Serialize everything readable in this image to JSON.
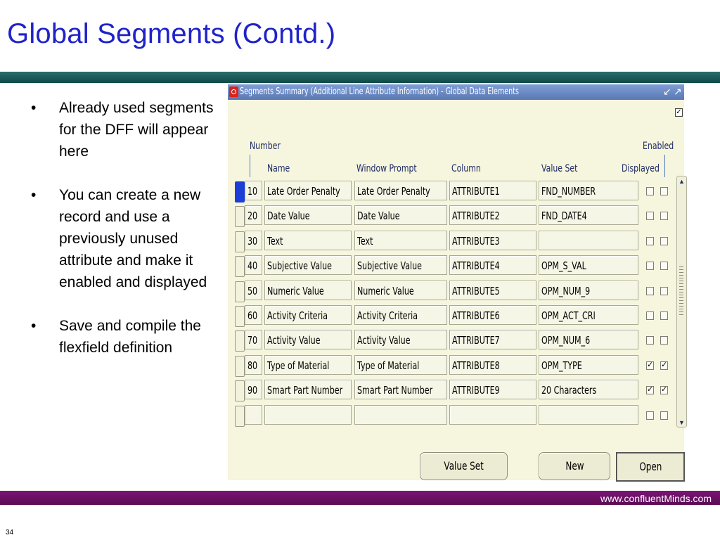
{
  "slide": {
    "title": "Global Segments (Contd.)",
    "bullets": [
      "Already used segments for the DFF will appear here",
      "You can create a new record and use a previously unused attribute and make it enabled and displayed",
      "Save and compile the flexfield definition"
    ],
    "bullet_char": "•",
    "website": "www.confluentMinds.com",
    "page_number": "34"
  },
  "window": {
    "title": "Segments Summary (Additional Line Attribute Information) - Global Data Elements",
    "header_check": "✓",
    "headers": {
      "number": "Number",
      "name": "Name",
      "window_prompt": "Window Prompt",
      "column": "Column",
      "value_set": "Value Set",
      "enabled": "Enabled",
      "displayed": "Displayed"
    },
    "rows": [
      {
        "number": "10",
        "name": "Late Order Penalty",
        "prompt": "Late Order Penalty",
        "column": "ATTRIBUTE1",
        "value_set": "FND_NUMBER",
        "enabled": "",
        "displayed": ""
      },
      {
        "number": "20",
        "name": "Date Value",
        "prompt": "Date Value",
        "column": "ATTRIBUTE2",
        "value_set": "FND_DATE4",
        "enabled": "",
        "displayed": ""
      },
      {
        "number": "30",
        "name": "Text",
        "prompt": "Text",
        "column": "ATTRIBUTE3",
        "value_set": "",
        "enabled": "",
        "displayed": ""
      },
      {
        "number": "40",
        "name": "Subjective Value",
        "prompt": "Subjective Value",
        "column": "ATTRIBUTE4",
        "value_set": "OPM_S_VAL",
        "enabled": "",
        "displayed": ""
      },
      {
        "number": "50",
        "name": "Numeric Value",
        "prompt": "Numeric Value",
        "column": "ATTRIBUTE5",
        "value_set": "OPM_NUM_9",
        "enabled": "",
        "displayed": ""
      },
      {
        "number": "60",
        "name": "Activity Criteria",
        "prompt": "Activity Criteria",
        "column": "ATTRIBUTE6",
        "value_set": "OPM_ACT_CRI",
        "enabled": "",
        "displayed": ""
      },
      {
        "number": "70",
        "name": "Activity Value",
        "prompt": "Activity Value",
        "column": "ATTRIBUTE7",
        "value_set": "OPM_NUM_6",
        "enabled": "",
        "displayed": ""
      },
      {
        "number": "80",
        "name": "Type of Material",
        "prompt": "Type of Material",
        "column": "ATTRIBUTE8",
        "value_set": "OPM_TYPE",
        "enabled": "✓",
        "displayed": "✓"
      },
      {
        "number": "90",
        "name": "Smart Part Number",
        "prompt": "Smart Part Number",
        "column": "ATTRIBUTE9",
        "value_set": "20 Characters",
        "enabled": "✓",
        "displayed": "✓"
      },
      {
        "number": "",
        "name": "",
        "prompt": "",
        "column": "",
        "value_set": "",
        "enabled": "",
        "displayed": ""
      }
    ],
    "buttons": {
      "value_set": "Value Set",
      "new": "New",
      "open": "Open"
    }
  }
}
